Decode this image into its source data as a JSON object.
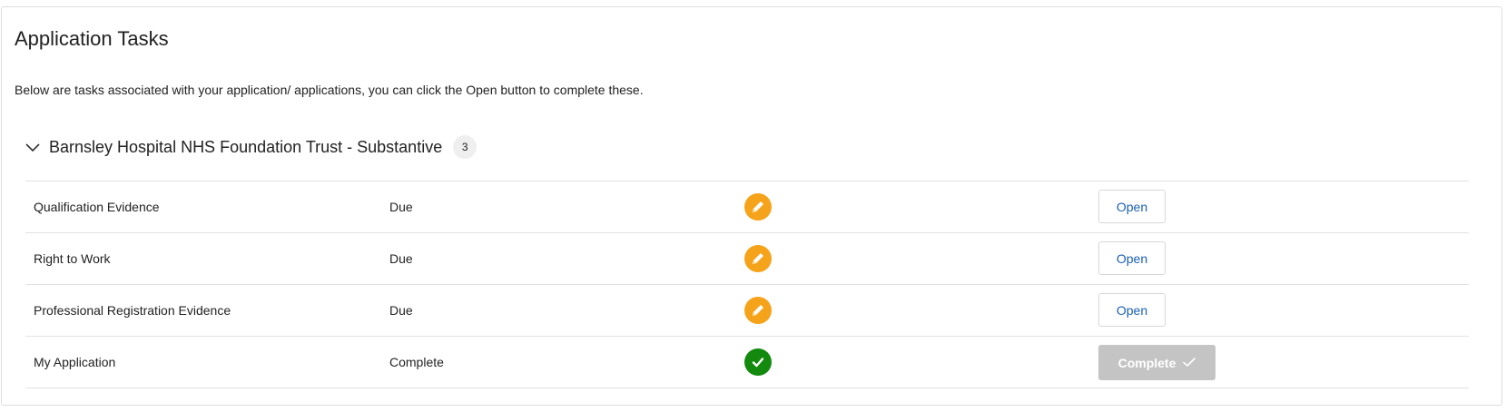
{
  "page": {
    "title": "Application Tasks",
    "intro": "Below are tasks associated with your application/ applications, you can click the Open button to complete these."
  },
  "group": {
    "title": "Barnsley Hospital NHS Foundation Trust - Substantive",
    "count": "3",
    "expanded": true,
    "icon": "chevron-down-icon"
  },
  "tasks": [
    {
      "name": "Qualification Evidence",
      "status": "Due",
      "icon": "pencil-icon",
      "action": "Open"
    },
    {
      "name": "Right to Work",
      "status": "Due",
      "icon": "pencil-icon",
      "action": "Open"
    },
    {
      "name": "Professional Registration Evidence",
      "status": "Due",
      "icon": "pencil-icon",
      "action": "Open"
    },
    {
      "name": "My Application",
      "status": "Complete",
      "icon": "check-icon",
      "action": "Complete"
    }
  ],
  "colors": {
    "due": "#f6a31c",
    "complete": "#138a0e",
    "link": "#1a5fb4",
    "disabled_button": "#c4c4c4"
  }
}
